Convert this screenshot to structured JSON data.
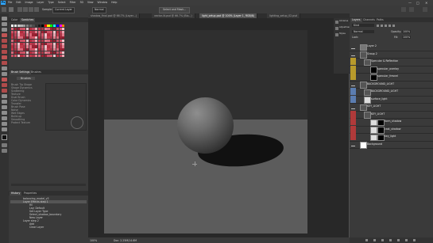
{
  "menubar": {
    "logo": "Ps",
    "items": [
      "File",
      "Edit",
      "Image",
      "Layer",
      "Type",
      "Select",
      "Filter",
      "3D",
      "View",
      "Window",
      "Help"
    ],
    "window_controls": [
      "—",
      "□",
      "✕"
    ]
  },
  "options": {
    "sample_label": "Sample:",
    "sample_value": "Current Layer",
    "mode_label": "Normal",
    "select_mask_label": "Select and Mask..."
  },
  "left_panel": {
    "top_tabs": [
      "Color",
      "Swatches"
    ],
    "brush_tabs": [
      "Brush Settings",
      "Brushes"
    ],
    "brush_settings_button": "Brushes",
    "brush_items": [
      "Brush Tip Shape",
      "Shape Dynamics",
      "Scattering",
      "Texture",
      "Dual Brush",
      "Color Dynamics",
      "Transfer",
      "Brush Pose",
      "Noise",
      "Wet Edges",
      "Build-up",
      "Smoothing",
      "Protect Texture"
    ],
    "bottom_tabs": [
      "History",
      "Properties"
    ],
    "history_items": [
      "balancing_model_v3",
      "Layer Effects step 1",
      "fill",
      "Lay: Default",
      "Set Layer Type",
      "Select_shadow_boundary",
      "New Layer",
      "Layer step 2",
      "Add",
      "Clear Layer"
    ]
  },
  "documents": {
    "tabs": [
      "shadow_final.psd @ 66.7% (Layer...)",
      "vector-lit.psd @ 66.7% (Blo...)",
      "light_setup.psd @ 100% (Layer 1, RGB/8)",
      "lighting_setup_02.psd"
    ]
  },
  "status": {
    "zoom": "100%",
    "doc": "Doc: 2.25M/14.6M"
  },
  "collapsed_panels": [
    "Libraries",
    "Adjustments",
    "Styles"
  ],
  "layers_panel": {
    "tabs": [
      "Layers",
      "Channels",
      "Paths"
    ],
    "kind_label": "Kind",
    "blend_mode": "Normal",
    "opacity_label": "Opacity:",
    "opacity": "100%",
    "lock_label": "Lock:",
    "fill_label": "Fill:",
    "fill": "100%",
    "layers": [
      {
        "name": "Layer 2",
        "tag": ""
      },
      {
        "name": "Group 2",
        "tag": ""
      },
      {
        "name": "Specular & Reflection",
        "tag": "#b89a2b"
      },
      {
        "name": "specular_overlay",
        "tag": "#b89a2b"
      },
      {
        "name": "specular_fresnel",
        "tag": "#b89a2b"
      },
      {
        "name": "BACKGROUND_LIGHT",
        "tag": ""
      },
      {
        "name": "BACKGROUND_LIGHT",
        "tag": "#5b7db0"
      },
      {
        "name": "surface_light",
        "tag": "#5b7db0"
      },
      {
        "name": "KEY_LIGHT",
        "tag": ""
      },
      {
        "name": "KEY_LIGHT",
        "tag": "#b03a3a"
      },
      {
        "name": "form_shadow",
        "tag": "#b03a3a"
      },
      {
        "name": "cast_shadow",
        "tag": "#b03a3a"
      },
      {
        "name": "key_light",
        "tag": "#b03a3a"
      },
      {
        "name": "Background",
        "tag": ""
      }
    ]
  }
}
